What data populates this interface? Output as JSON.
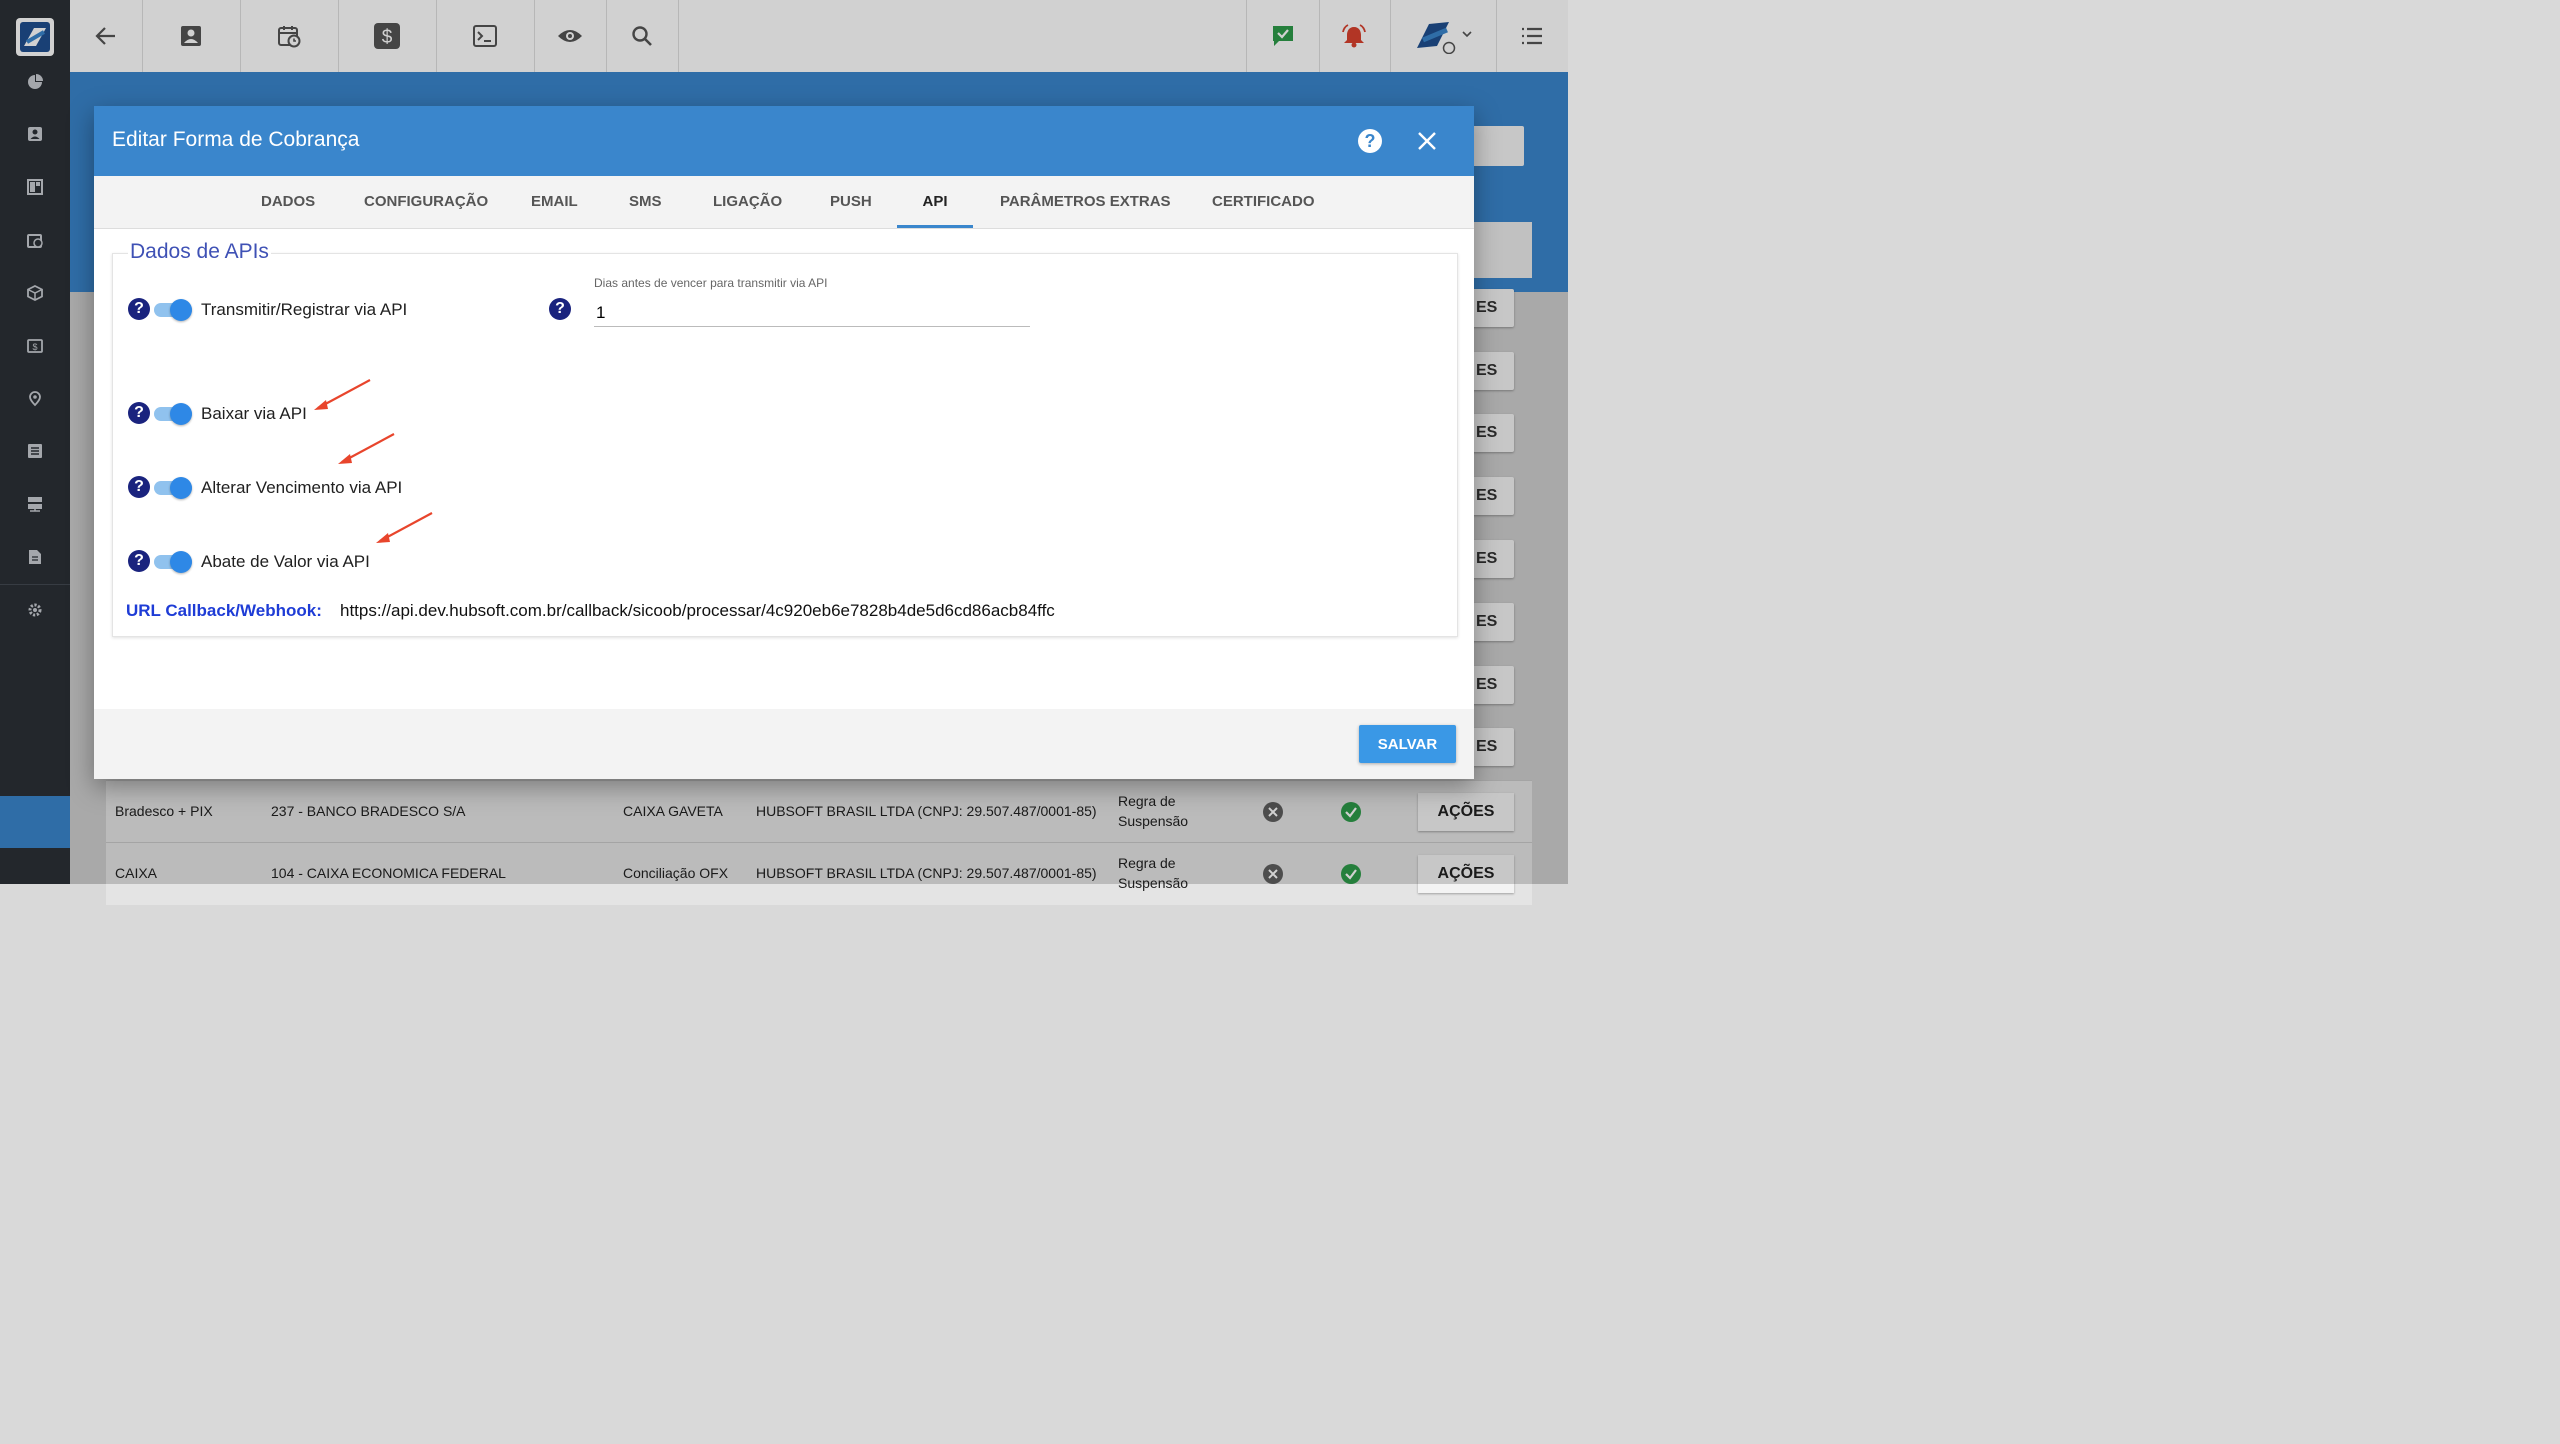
{
  "topbar": {
    "icons": [
      "back-arrow-icon",
      "contact-card-icon",
      "calendar-clock-icon",
      "dollar-icon",
      "terminal-icon",
      "eye-icon",
      "search-icon",
      "chat-check-icon",
      "bell-alert-icon",
      "company-logo",
      "list-menu-icon"
    ]
  },
  "sidebar": {
    "icons": [
      "pie-chart-icon",
      "person-icon",
      "dashboard-icon",
      "calendar-icon",
      "box-icon",
      "money-icon",
      "location-pin-icon",
      "document-list-icon",
      "server-icon",
      "file-icon",
      "gear-icon"
    ]
  },
  "background": {
    "side_button_label": "ES",
    "rows": [
      {
        "name": "Bradesco + PIX",
        "bank": "237 - BANCO BRADESCO S/A",
        "type": "CAIXA GAVETA",
        "company": "HUBSOFT BRASIL LTDA (CNPJ: 29.507.487/0001-85)",
        "rule_line1": "Regra de",
        "rule_line2": "Suspensão",
        "action": "AÇÕES"
      },
      {
        "name": "CAIXA",
        "bank": "104 - CAIXA ECONOMICA FEDERAL",
        "type": "Conciliação OFX",
        "company": "HUBSOFT BRASIL LTDA (CNPJ: 29.507.487/0001-85)",
        "rule_line1": "Regra de",
        "rule_line2": "Suspensão",
        "action": "AÇÕES"
      }
    ]
  },
  "modal": {
    "title": "Editar Forma de Cobrança",
    "tabs": [
      "DADOS",
      "CONFIGURAÇÃO",
      "EMAIL",
      "SMS",
      "LIGAÇÃO",
      "PUSH",
      "API",
      "PARÂMETROS EXTRAS",
      "CERTIFICADO"
    ],
    "selected_tab": "API",
    "section_title": "Dados de APIs",
    "toggles": [
      {
        "label": "Transmitir/Registrar via API",
        "on": true
      },
      {
        "label": "Baixar via API",
        "on": true
      },
      {
        "label": "Alterar Vencimento via API",
        "on": true
      },
      {
        "label": "Abate de Valor via API",
        "on": true
      }
    ],
    "days_field": {
      "label": "Dias antes de vencer para transmitir via API",
      "value": "1"
    },
    "url_label": "URL Callback/Webhook:",
    "url_value": "https://api.dev.hubsoft.com.br/callback/sicoob/processar/4c920eb6e7828b4de5d6cd86acb84ffc",
    "save_label": "SALVAR",
    "help_glyph": "?"
  },
  "colors": {
    "accent": "#3a86cc",
    "sidebar": "#2b3036",
    "section_title": "#3f51b5",
    "url_label": "#1e3cd6",
    "annotation_arrow": "#e8452c"
  }
}
